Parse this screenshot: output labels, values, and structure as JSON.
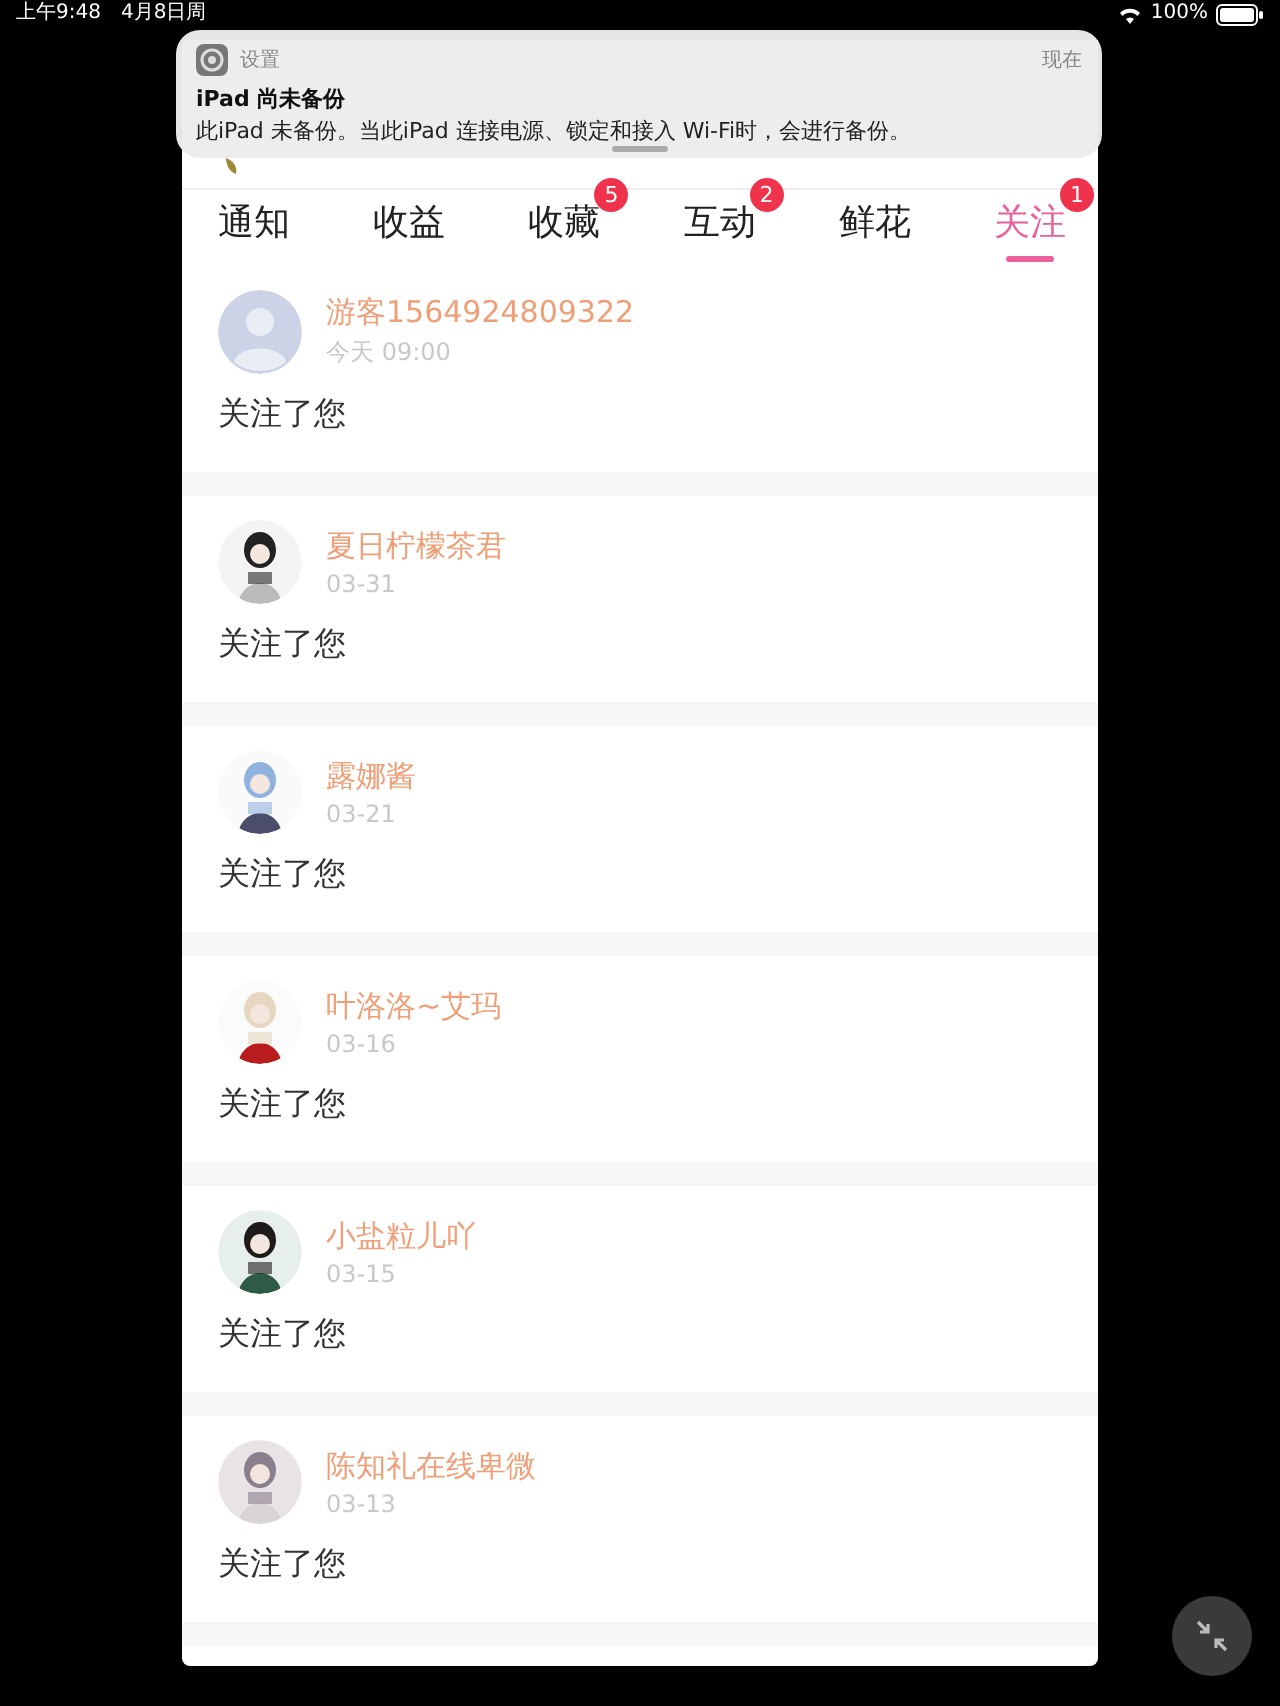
{
  "status_bar": {
    "time": "上午9:48",
    "date": "4月8日周",
    "battery": "100%"
  },
  "notification": {
    "app": "设置",
    "time": "现在",
    "title": "iPad 尚未备份",
    "body": "此iPad 未备份。当此iPad 连接电源、锁定和接入 Wi-Fi时，会进行备份。"
  },
  "tabs": [
    {
      "label": "通知",
      "selected": false
    },
    {
      "label": "收益",
      "selected": false
    },
    {
      "label": "收藏",
      "selected": false,
      "badge": "5"
    },
    {
      "label": "互动",
      "selected": false,
      "badge": "2"
    },
    {
      "label": "鲜花",
      "selected": false
    },
    {
      "label": "关注",
      "selected": true,
      "badge": "1"
    }
  ],
  "follows": [
    {
      "name": "游客1564924809322",
      "time": "今天 09:00",
      "message": "关注了您",
      "avatar": {
        "kind": "placeholder"
      }
    },
    {
      "name": "夏日柠檬茶君",
      "time": "03-31",
      "message": "关注了您"
    },
    {
      "name": "露娜酱",
      "time": "03-21",
      "message": "关注了您"
    },
    {
      "name": "叶洛洛~艾玛",
      "time": "03-16",
      "message": "关注了您"
    },
    {
      "name": "小盐粒儿吖",
      "time": "03-15",
      "message": "关注了您"
    },
    {
      "name": "陈知礼在线卑微",
      "time": "03-13",
      "message": "关注了您"
    }
  ]
}
